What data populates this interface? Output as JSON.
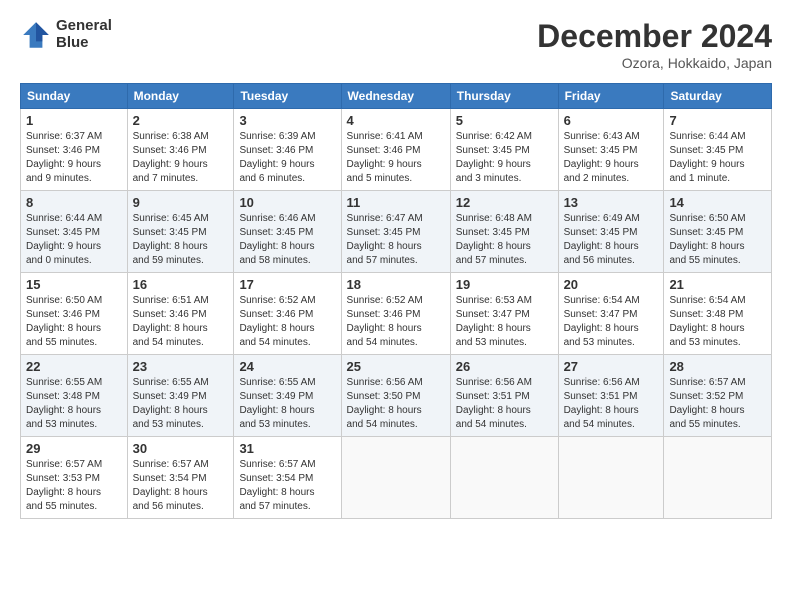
{
  "header": {
    "logo_line1": "General",
    "logo_line2": "Blue",
    "month": "December 2024",
    "location": "Ozora, Hokkaido, Japan"
  },
  "days_of_week": [
    "Sunday",
    "Monday",
    "Tuesday",
    "Wednesday",
    "Thursday",
    "Friday",
    "Saturday"
  ],
  "weeks": [
    [
      {
        "day": "1",
        "detail": "Sunrise: 6:37 AM\nSunset: 3:46 PM\nDaylight: 9 hours\nand 9 minutes."
      },
      {
        "day": "2",
        "detail": "Sunrise: 6:38 AM\nSunset: 3:46 PM\nDaylight: 9 hours\nand 7 minutes."
      },
      {
        "day": "3",
        "detail": "Sunrise: 6:39 AM\nSunset: 3:46 PM\nDaylight: 9 hours\nand 6 minutes."
      },
      {
        "day": "4",
        "detail": "Sunrise: 6:41 AM\nSunset: 3:46 PM\nDaylight: 9 hours\nand 5 minutes."
      },
      {
        "day": "5",
        "detail": "Sunrise: 6:42 AM\nSunset: 3:45 PM\nDaylight: 9 hours\nand 3 minutes."
      },
      {
        "day": "6",
        "detail": "Sunrise: 6:43 AM\nSunset: 3:45 PM\nDaylight: 9 hours\nand 2 minutes."
      },
      {
        "day": "7",
        "detail": "Sunrise: 6:44 AM\nSunset: 3:45 PM\nDaylight: 9 hours\nand 1 minute."
      }
    ],
    [
      {
        "day": "8",
        "detail": "Sunrise: 6:44 AM\nSunset: 3:45 PM\nDaylight: 9 hours\nand 0 minutes."
      },
      {
        "day": "9",
        "detail": "Sunrise: 6:45 AM\nSunset: 3:45 PM\nDaylight: 8 hours\nand 59 minutes."
      },
      {
        "day": "10",
        "detail": "Sunrise: 6:46 AM\nSunset: 3:45 PM\nDaylight: 8 hours\nand 58 minutes."
      },
      {
        "day": "11",
        "detail": "Sunrise: 6:47 AM\nSunset: 3:45 PM\nDaylight: 8 hours\nand 57 minutes."
      },
      {
        "day": "12",
        "detail": "Sunrise: 6:48 AM\nSunset: 3:45 PM\nDaylight: 8 hours\nand 57 minutes."
      },
      {
        "day": "13",
        "detail": "Sunrise: 6:49 AM\nSunset: 3:45 PM\nDaylight: 8 hours\nand 56 minutes."
      },
      {
        "day": "14",
        "detail": "Sunrise: 6:50 AM\nSunset: 3:45 PM\nDaylight: 8 hours\nand 55 minutes."
      }
    ],
    [
      {
        "day": "15",
        "detail": "Sunrise: 6:50 AM\nSunset: 3:46 PM\nDaylight: 8 hours\nand 55 minutes."
      },
      {
        "day": "16",
        "detail": "Sunrise: 6:51 AM\nSunset: 3:46 PM\nDaylight: 8 hours\nand 54 minutes."
      },
      {
        "day": "17",
        "detail": "Sunrise: 6:52 AM\nSunset: 3:46 PM\nDaylight: 8 hours\nand 54 minutes."
      },
      {
        "day": "18",
        "detail": "Sunrise: 6:52 AM\nSunset: 3:46 PM\nDaylight: 8 hours\nand 54 minutes."
      },
      {
        "day": "19",
        "detail": "Sunrise: 6:53 AM\nSunset: 3:47 PM\nDaylight: 8 hours\nand 53 minutes."
      },
      {
        "day": "20",
        "detail": "Sunrise: 6:54 AM\nSunset: 3:47 PM\nDaylight: 8 hours\nand 53 minutes."
      },
      {
        "day": "21",
        "detail": "Sunrise: 6:54 AM\nSunset: 3:48 PM\nDaylight: 8 hours\nand 53 minutes."
      }
    ],
    [
      {
        "day": "22",
        "detail": "Sunrise: 6:55 AM\nSunset: 3:48 PM\nDaylight: 8 hours\nand 53 minutes."
      },
      {
        "day": "23",
        "detail": "Sunrise: 6:55 AM\nSunset: 3:49 PM\nDaylight: 8 hours\nand 53 minutes."
      },
      {
        "day": "24",
        "detail": "Sunrise: 6:55 AM\nSunset: 3:49 PM\nDaylight: 8 hours\nand 53 minutes."
      },
      {
        "day": "25",
        "detail": "Sunrise: 6:56 AM\nSunset: 3:50 PM\nDaylight: 8 hours\nand 54 minutes."
      },
      {
        "day": "26",
        "detail": "Sunrise: 6:56 AM\nSunset: 3:51 PM\nDaylight: 8 hours\nand 54 minutes."
      },
      {
        "day": "27",
        "detail": "Sunrise: 6:56 AM\nSunset: 3:51 PM\nDaylight: 8 hours\nand 54 minutes."
      },
      {
        "day": "28",
        "detail": "Sunrise: 6:57 AM\nSunset: 3:52 PM\nDaylight: 8 hours\nand 55 minutes."
      }
    ],
    [
      {
        "day": "29",
        "detail": "Sunrise: 6:57 AM\nSunset: 3:53 PM\nDaylight: 8 hours\nand 55 minutes."
      },
      {
        "day": "30",
        "detail": "Sunrise: 6:57 AM\nSunset: 3:54 PM\nDaylight: 8 hours\nand 56 minutes."
      },
      {
        "day": "31",
        "detail": "Sunrise: 6:57 AM\nSunset: 3:54 PM\nDaylight: 8 hours\nand 57 minutes."
      },
      {
        "day": "",
        "detail": ""
      },
      {
        "day": "",
        "detail": ""
      },
      {
        "day": "",
        "detail": ""
      },
      {
        "day": "",
        "detail": ""
      }
    ]
  ]
}
